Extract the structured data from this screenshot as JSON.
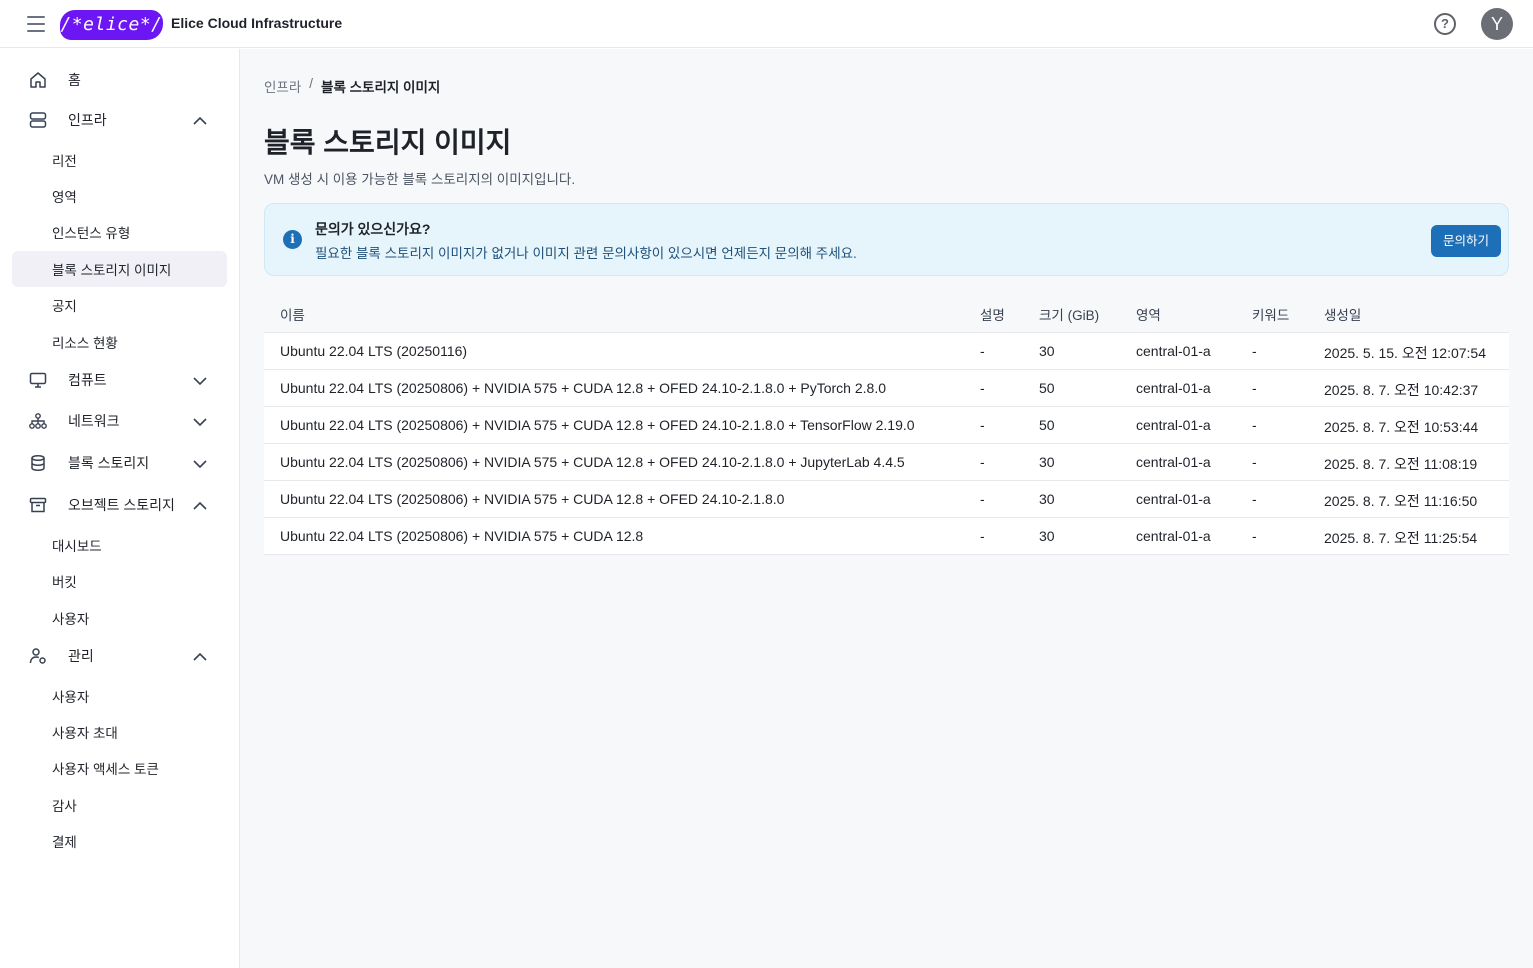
{
  "header": {
    "logo_text": "/*elice*/",
    "app_title": "Elice Cloud Infrastructure",
    "help_icon": "question-circle-icon",
    "avatar_initial": "Y"
  },
  "sidebar": {
    "home": "홈",
    "infra": "인프라",
    "infra_items": [
      "리전",
      "영역",
      "인스턴스 유형",
      "블록 스토리지 이미지",
      "공지",
      "리소스 현황"
    ],
    "compute": "컴퓨트",
    "network": "네트워크",
    "block_storage": "블록 스토리지",
    "object_storage": "오브젝트 스토리지",
    "object_items": [
      "대시보드",
      "버킷",
      "사용자"
    ],
    "manage": "관리",
    "manage_items": [
      "사용자",
      "사용자 초대",
      "사용자 액세스 토큰",
      "감사",
      "결제"
    ]
  },
  "breadcrumb": {
    "parent": "인프라",
    "separator": "/",
    "current": "블록 스토리지 이미지"
  },
  "page": {
    "title": "블록 스토리지 이미지",
    "description": "VM 생성 시 이용 가능한 블록 스토리지의 이미지입니다."
  },
  "notice": {
    "icon": "info-icon",
    "title": "문의가 있으신가요?",
    "text": "필요한 블록 스토리지 이미지가 없거나 이미지 관련 문의사항이 있으시면 언제든지 문의해 주세요.",
    "button": "문의하기"
  },
  "table": {
    "columns": {
      "name": "이름",
      "desc": "설명",
      "size": "크기 (GiB)",
      "zone": "영역",
      "keyword": "키워드",
      "created": "생성일"
    },
    "rows": [
      {
        "name": "Ubuntu 22.04 LTS (20250116)",
        "desc": "-",
        "size": "30",
        "zone": "central-01-a",
        "keyword": "-",
        "created": "2025. 5. 15. 오전 12:07:54"
      },
      {
        "name": "Ubuntu 22.04 LTS (20250806) + NVIDIA 575 + CUDA 12.8 + OFED 24.10-2.1.8.0 + PyTorch 2.8.0",
        "desc": "-",
        "size": "50",
        "zone": "central-01-a",
        "keyword": "-",
        "created": "2025. 8. 7. 오전 10:42:37"
      },
      {
        "name": "Ubuntu 22.04 LTS (20250806) + NVIDIA 575 + CUDA 12.8 + OFED 24.10-2.1.8.0 + TensorFlow 2.19.0",
        "desc": "-",
        "size": "50",
        "zone": "central-01-a",
        "keyword": "-",
        "created": "2025. 8. 7. 오전 10:53:44"
      },
      {
        "name": "Ubuntu 22.04 LTS (20250806) + NVIDIA 575 + CUDA 12.8 + OFED 24.10-2.1.8.0 + JupyterLab 4.4.5",
        "desc": "-",
        "size": "30",
        "zone": "central-01-a",
        "keyword": "-",
        "created": "2025. 8. 7. 오전 11:08:19"
      },
      {
        "name": "Ubuntu 22.04 LTS (20250806) + NVIDIA 575 + CUDA 12.8 + OFED 24.10-2.1.8.0",
        "desc": "-",
        "size": "30",
        "zone": "central-01-a",
        "keyword": "-",
        "created": "2025. 8. 7. 오전 11:16:50"
      },
      {
        "name": "Ubuntu 22.04 LTS (20250806) + NVIDIA 575 + CUDA 12.8",
        "desc": "-",
        "size": "30",
        "zone": "central-01-a",
        "keyword": "-",
        "created": "2025. 8. 7. 오전 11:25:54"
      }
    ]
  },
  "colors": {
    "brand": "#6c16f4",
    "primary_button": "#1d6fb8",
    "notice_bg": "#e6f5fb",
    "active_nav_bg": "#f1f0f7"
  }
}
